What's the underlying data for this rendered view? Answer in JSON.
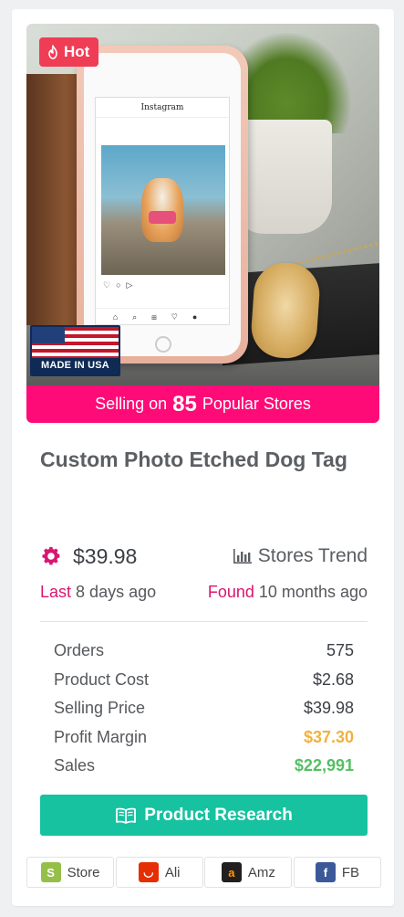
{
  "product": {
    "hot_label": "Hot",
    "made_in_label": "MADE IN USA",
    "selling_prefix": "Selling on",
    "selling_count": "85",
    "selling_suffix": "Popular Stores",
    "title": "Custom Photo Etched Dog Tag",
    "price": "$39.98",
    "stores_trend_label": "Stores Trend",
    "last_label": "Last",
    "last_value": "8 days ago",
    "found_label": "Found",
    "found_value": "10 months ago"
  },
  "phone_screen": {
    "app_title": "Instagram"
  },
  "stats": [
    {
      "label": "Orders",
      "value": "575",
      "style": "normal"
    },
    {
      "label": "Product Cost",
      "value": "$2.68",
      "style": "normal"
    },
    {
      "label": "Selling Price",
      "value": "$39.98",
      "style": "normal"
    },
    {
      "label": "Profit Margin",
      "value": "$37.30",
      "style": "profit"
    },
    {
      "label": "Sales",
      "value": "$22,991",
      "style": "sales"
    }
  ],
  "actions": {
    "research_label": "Product Research",
    "links": [
      {
        "label": "Store",
        "icon": "shopify-icon"
      },
      {
        "label": "Ali",
        "icon": "aliexpress-icon"
      },
      {
        "label": "Amz",
        "icon": "amazon-icon"
      },
      {
        "label": "FB",
        "icon": "facebook-icon"
      }
    ]
  },
  "colors": {
    "hot": "#ef3d55",
    "selling_bar": "#ff0b78",
    "accent_pink": "#d91670",
    "profit": "#f0b23e",
    "sales": "#55bf61",
    "research_button": "#17c2a0"
  }
}
